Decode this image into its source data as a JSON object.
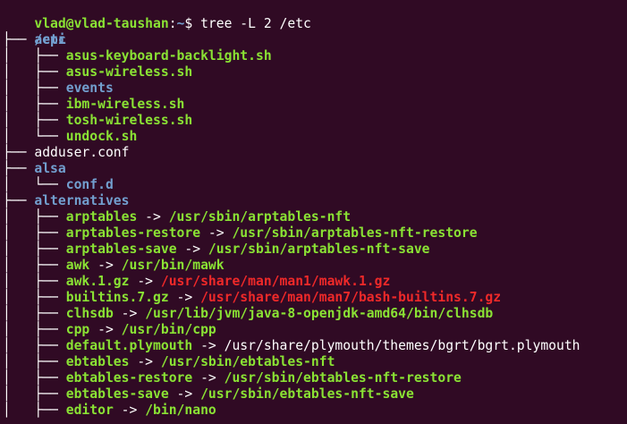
{
  "prompt": {
    "user_host": "vlad@vlad-taushan",
    "sep": ":",
    "cwd": "~",
    "symbol": "$",
    "command": " tree -L 2 /etc"
  },
  "root": "/etc",
  "entries": [
    {
      "tree": "├── ",
      "name": "acpi",
      "kind": "dir"
    },
    {
      "tree": "│   ├── ",
      "name": "asus-keyboard-backlight.sh",
      "kind": "exec"
    },
    {
      "tree": "│   ├── ",
      "name": "asus-wireless.sh",
      "kind": "exec"
    },
    {
      "tree": "│   ├── ",
      "name": "events",
      "kind": "dir"
    },
    {
      "tree": "│   ├── ",
      "name": "ibm-wireless.sh",
      "kind": "exec"
    },
    {
      "tree": "│   ├── ",
      "name": "tosh-wireless.sh",
      "kind": "exec"
    },
    {
      "tree": "│   └── ",
      "name": "undock.sh",
      "kind": "exec"
    },
    {
      "tree": "├── ",
      "name": "adduser.conf",
      "kind": "plain"
    },
    {
      "tree": "├── ",
      "name": "alsa",
      "kind": "dir"
    },
    {
      "tree": "│   └── ",
      "name": "conf.d",
      "kind": "dir"
    },
    {
      "tree": "├── ",
      "name": "alternatives",
      "kind": "dir"
    },
    {
      "tree": "│   ├── ",
      "name": "arptables",
      "kind": "exec",
      "arrow": " -> ",
      "target": "/usr/sbin/arptables-nft",
      "target_kind": "ok"
    },
    {
      "tree": "│   ├── ",
      "name": "arptables-restore",
      "kind": "exec",
      "arrow": " -> ",
      "target": "/usr/sbin/arptables-nft-restore",
      "target_kind": "ok"
    },
    {
      "tree": "│   ├── ",
      "name": "arptables-save",
      "kind": "exec",
      "arrow": " -> ",
      "target": "/usr/sbin/arptables-nft-save",
      "target_kind": "ok"
    },
    {
      "tree": "│   ├── ",
      "name": "awk",
      "kind": "exec",
      "arrow": " -> ",
      "target": "/usr/bin/mawk",
      "target_kind": "ok"
    },
    {
      "tree": "│   ├── ",
      "name": "awk.1.gz",
      "kind": "exec",
      "arrow": " -> ",
      "target": "/usr/share/man/man1/mawk.1.gz",
      "target_kind": "broken"
    },
    {
      "tree": "│   ├── ",
      "name": "builtins.7.gz",
      "kind": "exec",
      "arrow": " -> ",
      "target": "/usr/share/man/man7/bash-builtins.7.gz",
      "target_kind": "broken"
    },
    {
      "tree": "│   ├── ",
      "name": "clhsdb",
      "kind": "exec",
      "arrow": " -> ",
      "target": "/usr/lib/jvm/java-8-openjdk-amd64/bin/clhsdb",
      "target_kind": "ok"
    },
    {
      "tree": "│   ├── ",
      "name": "cpp",
      "kind": "exec",
      "arrow": " -> ",
      "target": "/usr/bin/cpp",
      "target_kind": "ok"
    },
    {
      "tree": "│   ├── ",
      "name": "default.plymouth",
      "kind": "exec",
      "arrow": " -> ",
      "target": "/usr/share/plymouth/themes/bgrt/bgrt.plymouth",
      "target_kind": "plain"
    },
    {
      "tree": "│   ├── ",
      "name": "ebtables",
      "kind": "exec",
      "arrow": " -> ",
      "target": "/usr/sbin/ebtables-nft",
      "target_kind": "ok"
    },
    {
      "tree": "│   ├── ",
      "name": "ebtables-restore",
      "kind": "exec",
      "arrow": " -> ",
      "target": "/usr/sbin/ebtables-nft-restore",
      "target_kind": "ok"
    },
    {
      "tree": "│   ├── ",
      "name": "ebtables-save",
      "kind": "exec",
      "arrow": " -> ",
      "target": "/usr/sbin/ebtables-nft-save",
      "target_kind": "ok"
    },
    {
      "tree": "│   ├── ",
      "name": "editor",
      "kind": "exec",
      "arrow": " -> ",
      "target": "/bin/nano",
      "target_kind": "ok"
    }
  ],
  "colors": {
    "background": "#300a24",
    "green": "#8ae234",
    "blue": "#729fcf",
    "red": "#ef2929",
    "white": "#ffffff"
  }
}
